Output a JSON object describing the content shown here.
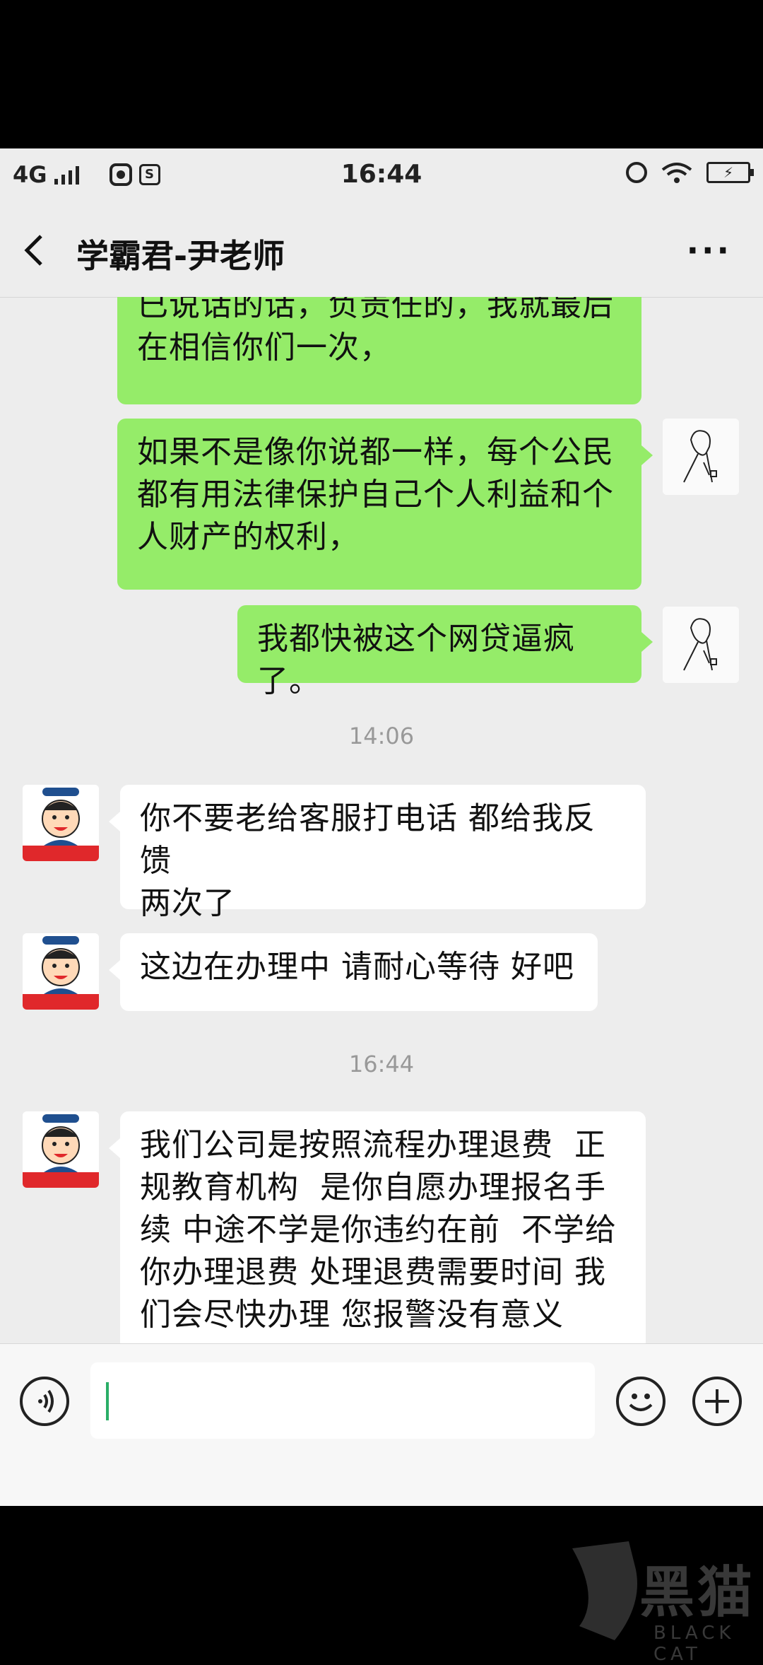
{
  "status_bar": {
    "network": "4G",
    "time": "16:44",
    "mini_icon_label": "S"
  },
  "header": {
    "title": "学霸君-尹老师",
    "more_label": "···"
  },
  "messages": [
    {
      "from": "me",
      "text": "已说话的话，负责任的，我就最后\n在相信你们一次，"
    },
    {
      "from": "me",
      "text": "如果不是像你说都一样，每个公民\n都有用法律保护自己个人利益和个\n人财产的权利，",
      "avatar": "user-avatar"
    },
    {
      "from": "me",
      "text": "我都快被这个网贷逼疯了。",
      "avatar": "user-avatar"
    },
    {
      "type": "timestamp",
      "text": "14:06"
    },
    {
      "from": "them",
      "text": "你不要老给客服打电话 都给我反馈\n两次了",
      "avatar": "teacher-avatar"
    },
    {
      "from": "them",
      "text": "这边在办理中 请耐心等待 好吧",
      "avatar": "teacher-avatar"
    },
    {
      "type": "timestamp",
      "text": "16:44"
    },
    {
      "from": "them",
      "text": "我们公司是按照流程办理退费  正\n规教育机构  是你自愿办理报名手\n续 中途不学是你违约在前  不学给\n你办理退费 处理退费需要时间 我\n们会尽快办理 您报警没有意义",
      "avatar": "teacher-avatar"
    }
  ],
  "input": {
    "value": ""
  },
  "watermark": {
    "text": "黑猫",
    "sub": "BLACK CAT"
  },
  "colors": {
    "my_bubble": "#95ec69",
    "their_bubble": "#ffffff",
    "caret": "#2aae67"
  }
}
